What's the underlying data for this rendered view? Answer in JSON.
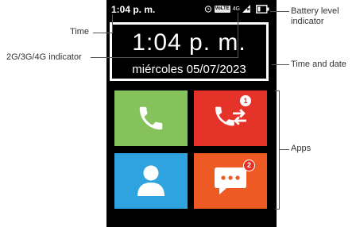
{
  "status_bar": {
    "time": "1:04 p. m.",
    "volte": "VoLTE",
    "network": "4G"
  },
  "clock_widget": {
    "time": "1:04 p. m.",
    "date": "miércoles 05/07/2023"
  },
  "apps": [
    {
      "name": "phone",
      "icon": "phone-icon",
      "color": "#86c25b"
    },
    {
      "name": "call-log",
      "icon": "call-log-icon",
      "color": "#e5332a",
      "badge": "1"
    },
    {
      "name": "contacts",
      "icon": "contact-icon",
      "color": "#2fa3e0"
    },
    {
      "name": "messages",
      "icon": "message-icon",
      "color": "#ee5a24",
      "badge": "2"
    }
  ],
  "callouts": {
    "time": "Time",
    "network_indicator": "2G/3G/4G indicator",
    "battery_line1": "Battery level",
    "battery_line2": "indicator",
    "time_and_date": "Time and date",
    "apps": "Apps"
  }
}
